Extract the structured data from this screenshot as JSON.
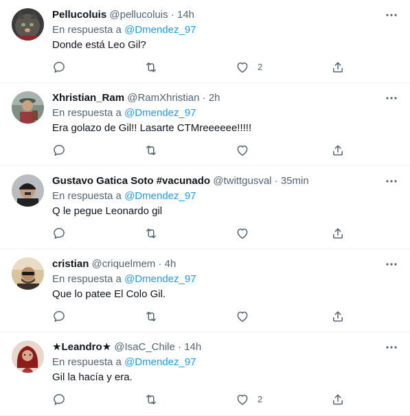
{
  "colors": {
    "text_primary": "#0f1419",
    "text_secondary": "#536471",
    "mention": "#1d9bf0",
    "divider": "#eff3f4"
  },
  "reply_prefix": "En respuesta a",
  "tweets": [
    {
      "name": "Pellucoluis",
      "handle": "@pellucoluis",
      "separator": "·",
      "time": "14h",
      "mention": "@Dmendez_97",
      "text": "Donde está Leo Gil?",
      "like_count": "2",
      "avatar_icon": "cat-avatar"
    },
    {
      "name": "Xhristian_Ram",
      "handle": "@RamXhristian",
      "separator": "·",
      "time": "2h",
      "mention": "@Dmendez_97",
      "text": "Era golazo de Gil!! Lasarte CTMreeeeee!!!!!",
      "like_count": "",
      "avatar_icon": "person-outdoor-avatar"
    },
    {
      "name": "Gustavo Gatica Soto #vacunado",
      "handle": "@twittgusval",
      "separator": "·",
      "time": "35min",
      "mention": "@Dmendez_97",
      "text": "Q le pegue Leonardo gil",
      "like_count": "",
      "avatar_icon": "person-beanie-avatar"
    },
    {
      "name": "cristian",
      "handle": "@criquelmem",
      "separator": "·",
      "time": "4h",
      "mention": "@Dmendez_97",
      "text": "Que lo patee El Colo Gil.",
      "like_count": "",
      "avatar_icon": "person-sunglasses-avatar"
    },
    {
      "name": "★Leandro★",
      "handle": "@IsaC_Chile",
      "separator": "·",
      "time": "14h",
      "mention": "@Dmendez_97",
      "text": "Gil la hacía y era.",
      "like_count": "2",
      "avatar_icon": "person-red-hair-avatar"
    }
  ]
}
